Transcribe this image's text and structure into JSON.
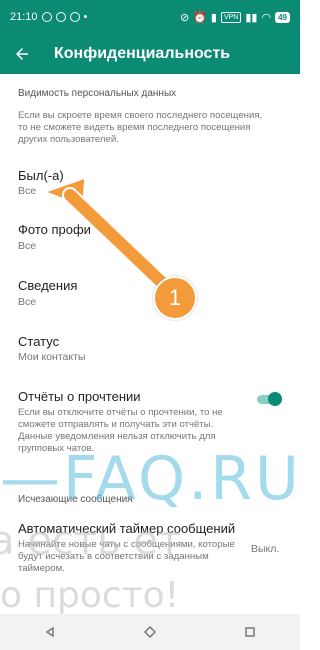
{
  "status_bar": {
    "time": "21:10",
    "battery": "49"
  },
  "header": {
    "back_icon": "arrow-left-icon",
    "title": "Конфиденциальность"
  },
  "visibility": {
    "section_title": "Видимость персональных данных",
    "description": "Если вы скроете время своего последнего посещения, то не сможете видеть время последнего посещения других пользователей."
  },
  "rows": {
    "last_seen": {
      "title": "Был(-а)",
      "value": "Все"
    },
    "photo": {
      "title": "Фото профи",
      "value": "Все"
    },
    "about": {
      "title": "Сведения",
      "value": "Все"
    },
    "status": {
      "title": "Статус",
      "value": "Мои контакты"
    },
    "read_receipts": {
      "title": "Отчёты о прочтении",
      "description": "Если вы отключите отчёты о прочтении, то не сможете отправлять и получать эти отчёты. Данные уведомления нельзя отключить для групповых чатов.",
      "enabled": true
    }
  },
  "disappearing": {
    "section_title": "Исчезающие сообщения",
    "timer_title": "Автоматический таймер сообщений",
    "timer_description": "Начинайте новые чаты с сообщениями, которые будут исчезать в соответствии с заданным таймером.",
    "timer_value": "Выкл."
  },
  "annotation": {
    "number": "1",
    "color": "#f39a3a"
  },
  "watermark": {
    "main": "—FAQ.RU",
    "line2": "а есть ет",
    "line3": "о просто!"
  },
  "colors": {
    "primary": "#0b8a74",
    "accent": "#f39a3a"
  }
}
